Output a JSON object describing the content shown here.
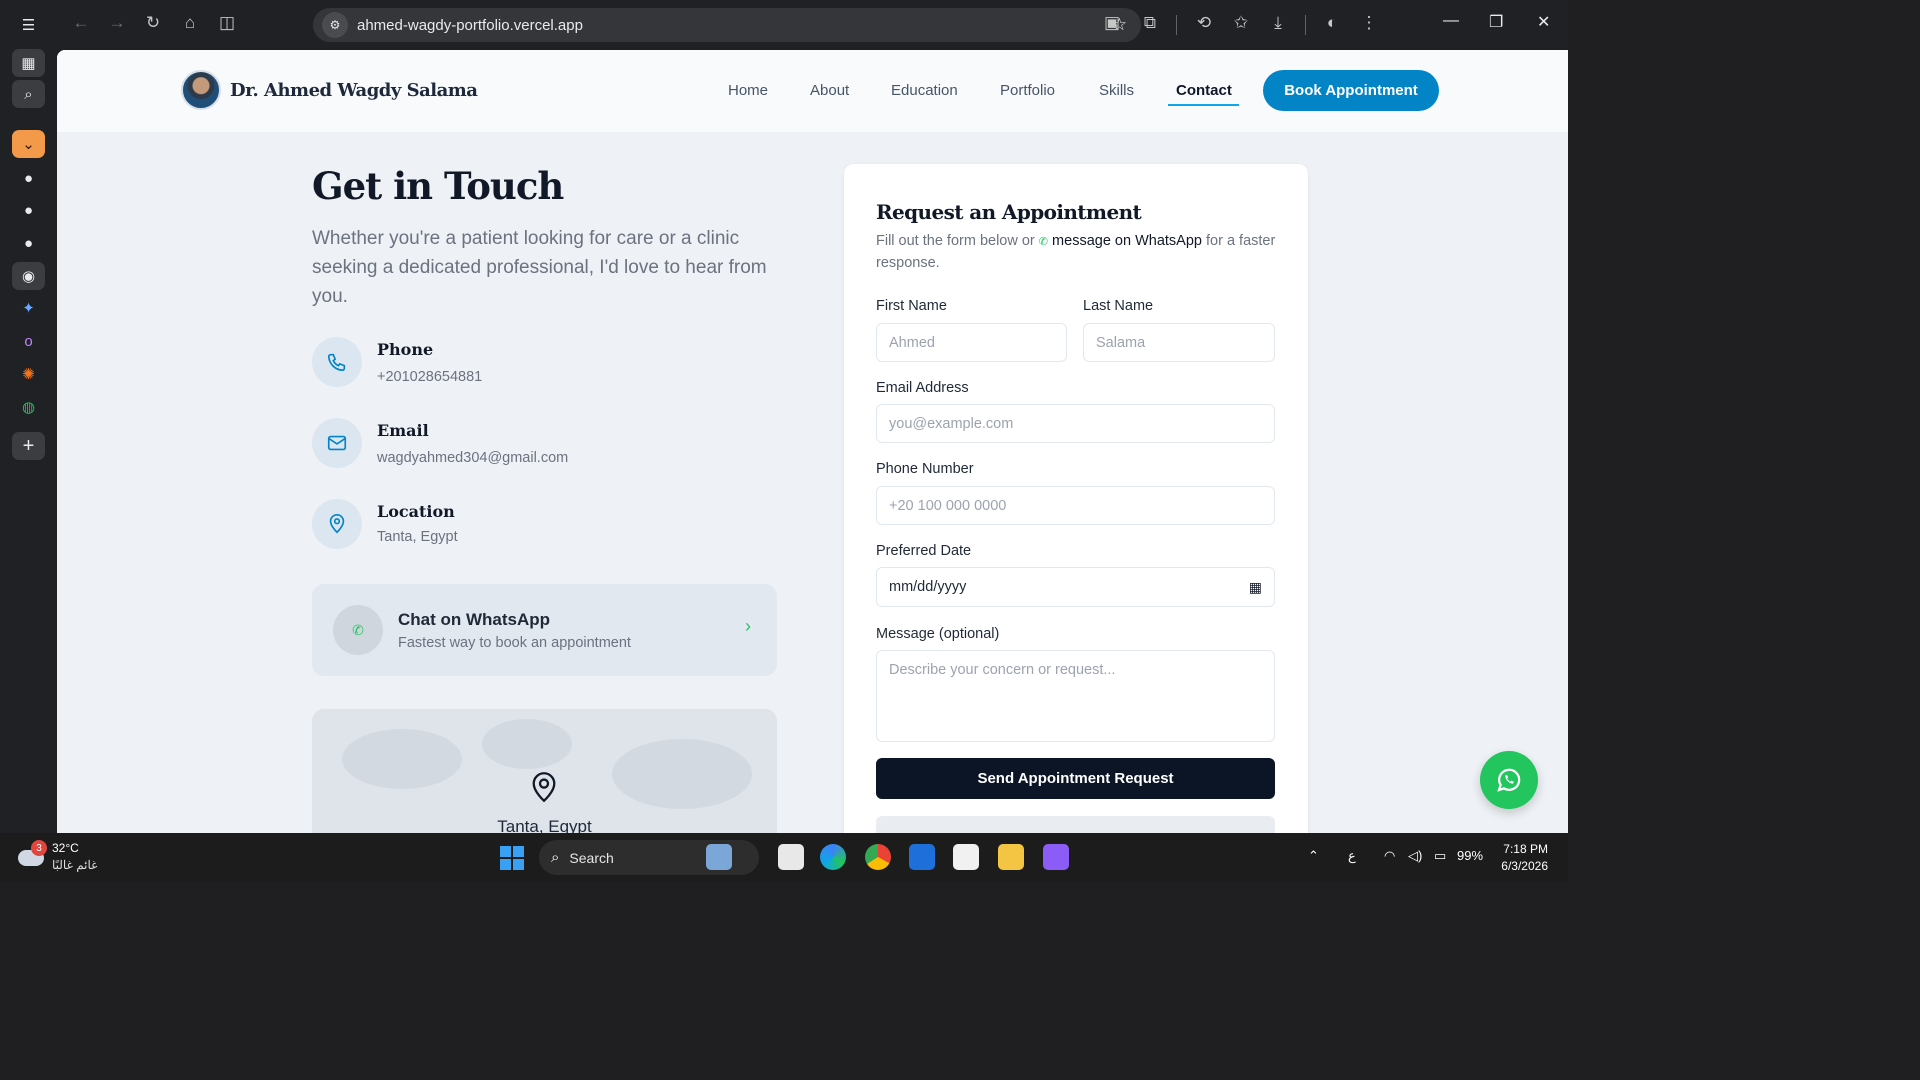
{
  "browser": {
    "url": "ahmed-wagdy-portfolio.vercel.app"
  },
  "site": {
    "brand_name": "Dr. Ahmed Wagdy Salama",
    "nav": [
      {
        "label": "Home"
      },
      {
        "label": "About"
      },
      {
        "label": "Education"
      },
      {
        "label": "Portfolio"
      },
      {
        "label": "Skills"
      },
      {
        "label": "Contact",
        "active": true
      }
    ],
    "cta_label": "Book Appointment"
  },
  "contact": {
    "title": "Get in Touch",
    "lead": "Whether you're a patient looking for care or a clinic seeking a dedicated professional, I'd love to hear from you.",
    "items": [
      {
        "icon": "phone-icon",
        "label": "Phone",
        "value": "+201028654881"
      },
      {
        "icon": "mail-icon",
        "label": "Email",
        "value": "wagdyahmed304@gmail.com"
      },
      {
        "icon": "map-pin-icon",
        "label": "Location",
        "value": "Tanta, Egypt"
      }
    ],
    "whatsapp": {
      "title": "Chat on WhatsApp",
      "subtitle": "Fastest way to book an appointment"
    },
    "map_label": "Tanta, Egypt"
  },
  "form": {
    "title": "Request an Appointment",
    "subtitle_pre": "Fill out the form below or",
    "subtitle_link": "message on WhatsApp",
    "subtitle_post": "for a faster response.",
    "first_name": {
      "label": "First Name",
      "placeholder": "Ahmed"
    },
    "last_name": {
      "label": "Last Name",
      "placeholder": "Salama"
    },
    "email": {
      "label": "Email Address",
      "placeholder": "you@example.com"
    },
    "phone": {
      "label": "Phone Number",
      "placeholder": "+20 100 000 0000"
    },
    "date": {
      "label": "Preferred Date",
      "value": "mm/dd/yyyy"
    },
    "message": {
      "label": "Message (optional)",
      "placeholder": "Describe your concern or request..."
    },
    "submit_label": "Send Appointment Request"
  },
  "taskbar": {
    "weather_badge": "3",
    "temperature": "32°C",
    "condition": "غائم غالبًا",
    "search_label": "Search",
    "lang": "ع",
    "battery": "99%",
    "time": "7:18 PM",
    "date": "6/3/2026"
  },
  "colors": {
    "accent": "#0284c7",
    "whatsapp": "#22c55e",
    "dark_button": "#0b1526"
  }
}
